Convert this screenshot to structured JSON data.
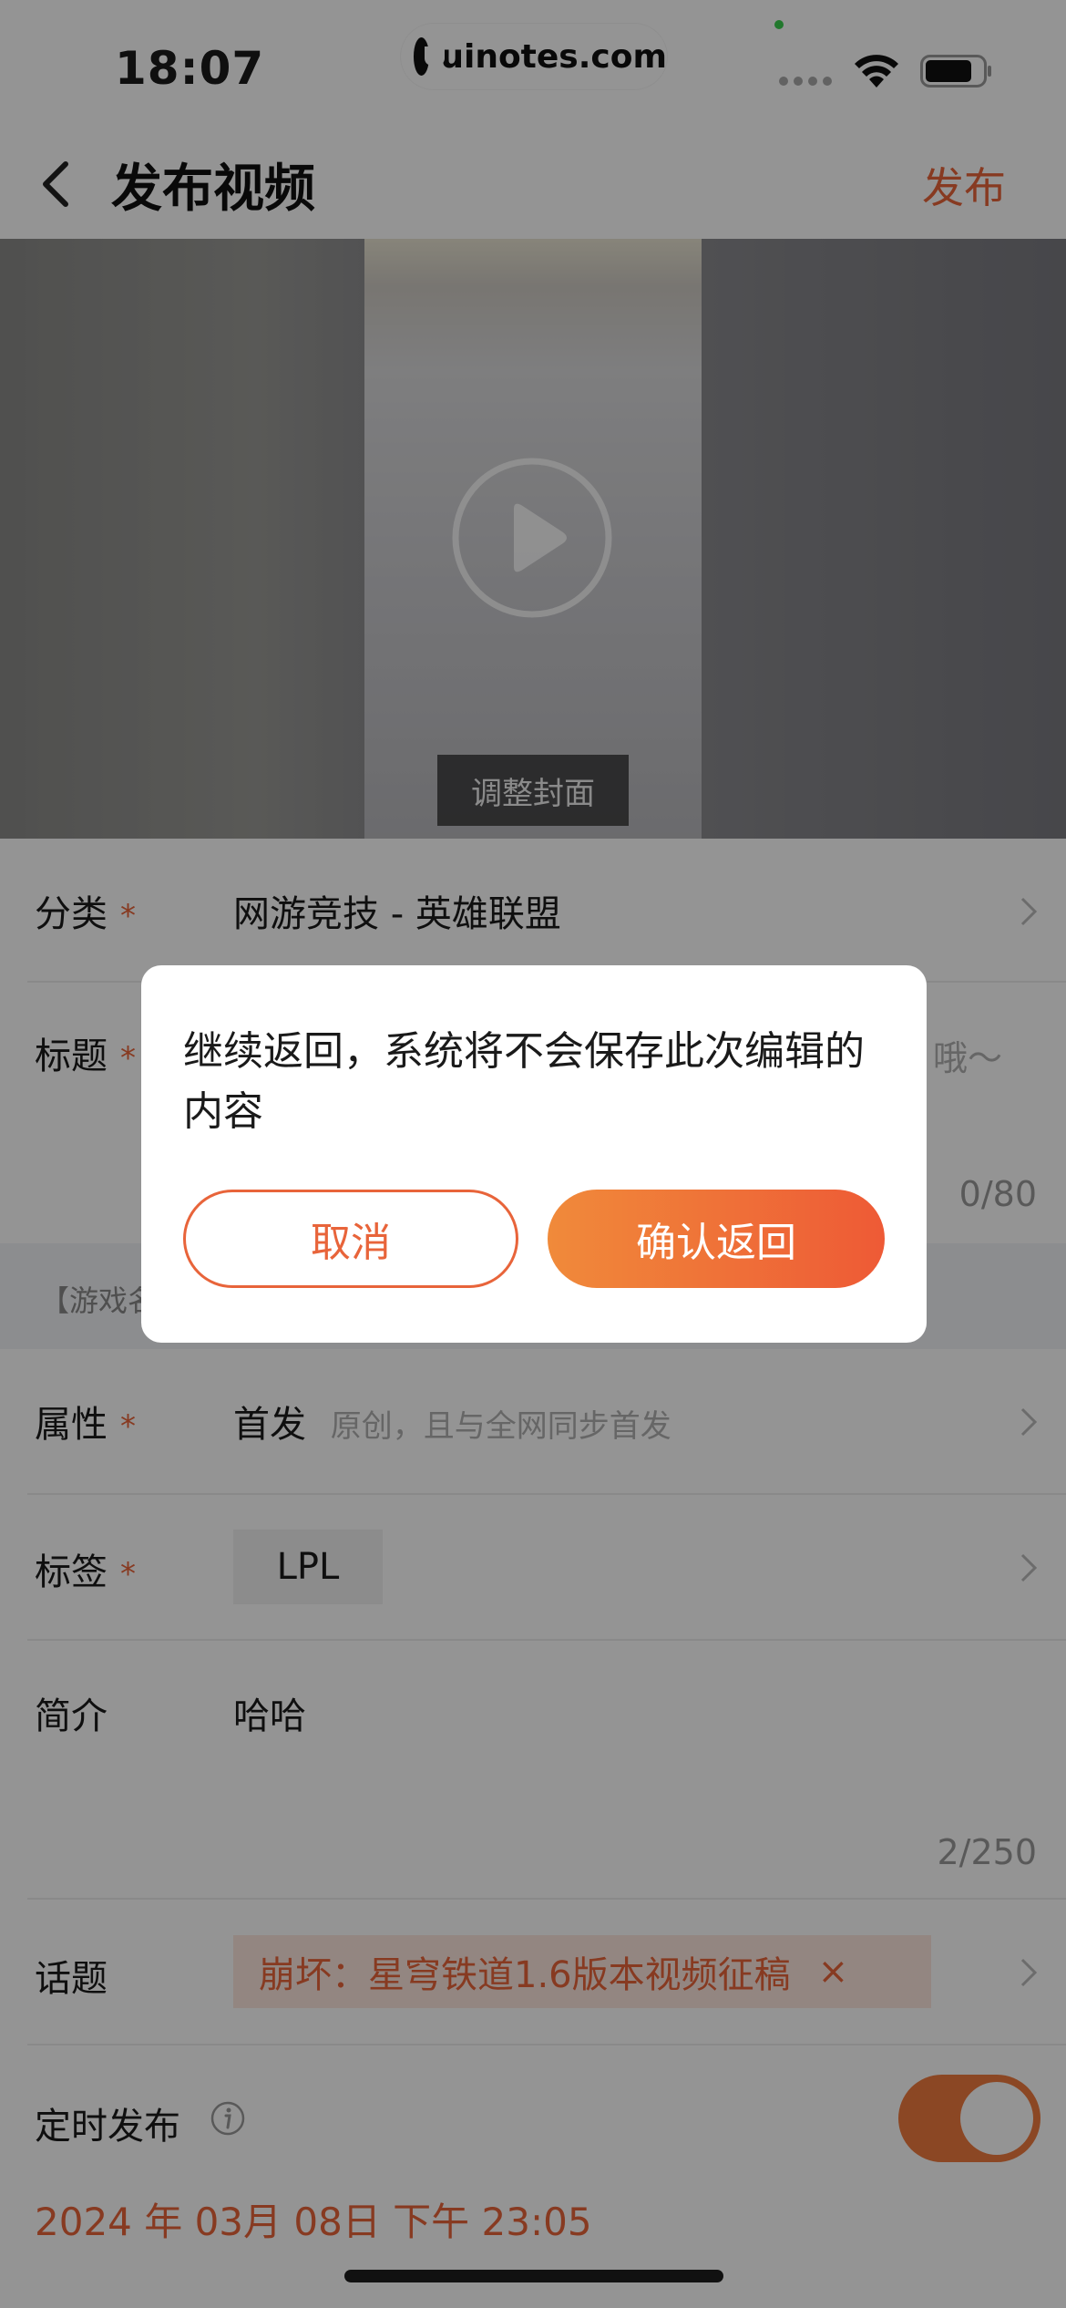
{
  "status_bar": {
    "time": "18:07",
    "url": "uinotes.com"
  },
  "nav": {
    "title": "发布视频",
    "publish": "发布",
    "back_icon": "chevron-left-icon"
  },
  "video": {
    "adjust_cover": "调整封面",
    "play_icon": "play-circle-icon"
  },
  "form": {
    "category": {
      "label": "分类",
      "required": "*",
      "value": "网游竞技 - 英雄联盟"
    },
    "title": {
      "label": "标题",
      "required": "*",
      "hint_tail": "哦～",
      "counter": "0/80"
    },
    "game_strip": "【游戏名",
    "attribute": {
      "label": "属性",
      "required": "*",
      "value": "首发",
      "hint": "原创，且与全网同步首发"
    },
    "tags": {
      "label": "标签",
      "required": "*",
      "chip": "LPL"
    },
    "intro": {
      "label": "简介",
      "value": "哈哈",
      "counter": "2/250"
    },
    "topic": {
      "label": "话题",
      "chip": "崩坏：星穹铁道1.6版本视频征稿",
      "close": "×"
    },
    "schedule": {
      "label": "定时发布",
      "enabled": true,
      "datetime": "2024 年 03月 08日 下午 23:05"
    }
  },
  "dialog": {
    "message": "继续返回，系统将不会保存此次编辑的内容",
    "cancel": "取消",
    "confirm": "确认返回"
  },
  "colors": {
    "accent": "#e8643a",
    "overlay": "rgba(0,0,0,0.42)"
  }
}
